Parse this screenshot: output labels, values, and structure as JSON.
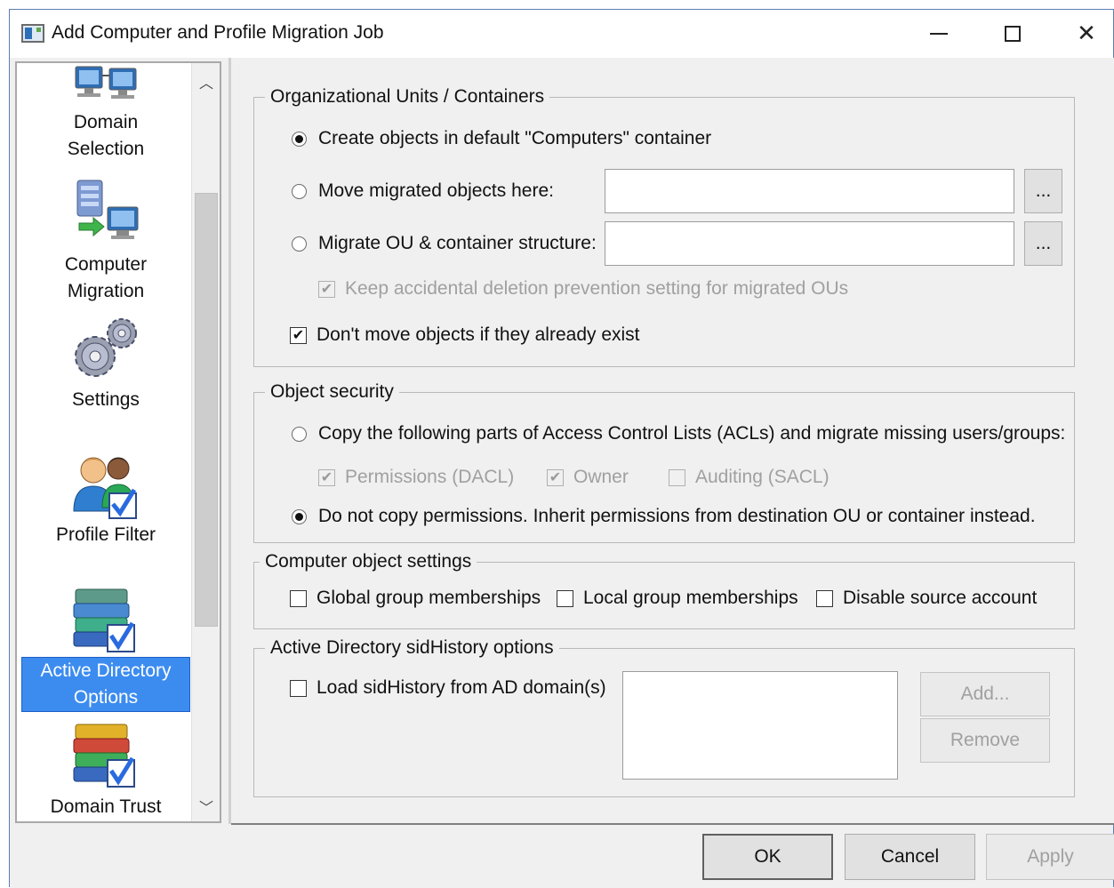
{
  "window": {
    "title": "Add Computer and Profile Migration Job"
  },
  "nav": {
    "items": [
      {
        "label_line1": "Domain",
        "label_line2": "Selection",
        "icon": "computers-icon",
        "selected": false
      },
      {
        "label_line1": "Computer",
        "label_line2": "Migration",
        "icon": "server-migration-icon",
        "selected": false
      },
      {
        "label_line1": "Settings",
        "label_line2": "",
        "icon": "gears-icon",
        "selected": false
      },
      {
        "label_line1": "Profile Filter",
        "label_line2": "",
        "icon": "users-check-icon",
        "selected": false
      },
      {
        "label_line1": "Active Directory",
        "label_line2": "Options",
        "icon": "books-check-icon",
        "selected": true
      },
      {
        "label_line1": "Domain Trust",
        "label_line2": "",
        "icon": "books-trust-icon",
        "selected": false
      }
    ]
  },
  "ou_group": {
    "legend": "Organizational Units / Containers",
    "opt_default": "Create objects in default \"Computers\" container",
    "opt_move": "Move migrated objects here:",
    "opt_migrate": "Migrate OU & container structure:",
    "browse_label": "...",
    "keep_deletion": "Keep accidental deletion prevention setting for migrated OUs",
    "dont_move": "Don't move objects if they already exist"
  },
  "security_group": {
    "legend": "Object security",
    "opt_copy": "Copy the following parts of Access Control Lists (ACLs) and migrate missing users/groups:",
    "permissions": "Permissions (DACL)",
    "owner": "Owner",
    "auditing": "Auditing (SACL)",
    "opt_nocopy": "Do not copy permissions. Inherit permissions from destination OU or container instead."
  },
  "computer_group": {
    "legend": "Computer object settings",
    "global": "Global group memberships",
    "local": "Local group memberships",
    "disable": "Disable source account"
  },
  "sid_group": {
    "legend": "Active Directory sidHistory options",
    "load": "Load sidHistory from AD domain(s)",
    "add": "Add...",
    "remove": "Remove"
  },
  "footer": {
    "ok": "OK",
    "cancel": "Cancel",
    "apply": "Apply"
  }
}
